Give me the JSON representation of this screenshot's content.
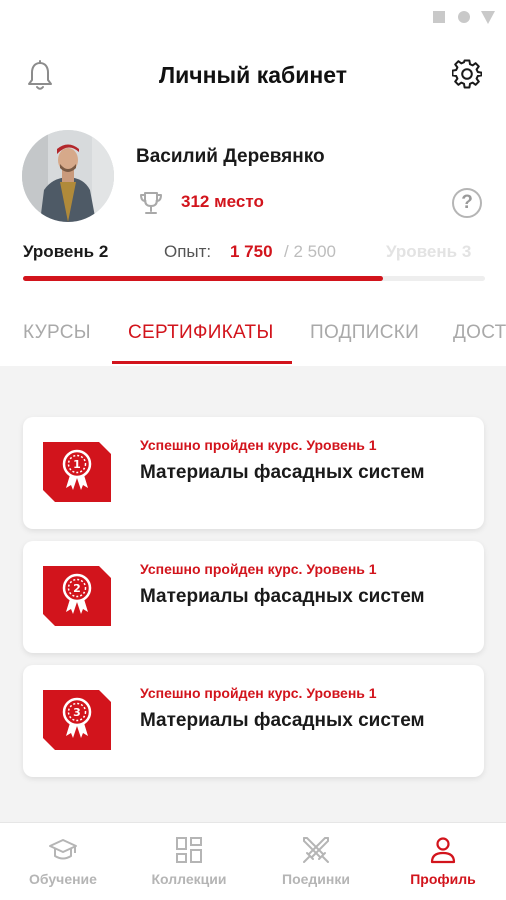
{
  "colors": {
    "accent": "#d2141c",
    "muted": "#a9a9a9",
    "background": "#f3f3f3"
  },
  "header": {
    "title": "Личный кабинет",
    "left_icon": "bell-icon",
    "right_icon": "gear-icon"
  },
  "profile": {
    "name": "Василий Деревянко",
    "rank": "312 место",
    "rank_icon": "trophy-icon",
    "help_icon": "help-icon",
    "help_glyph": "?"
  },
  "level": {
    "current": "Уровень 2",
    "exp_label": "Опыт:",
    "exp_current": "1 750",
    "exp_max": "/ 2 500",
    "next": "Уровень 3",
    "progress": 0.78
  },
  "tabs": [
    {
      "label": "КУРСЫ",
      "active": false
    },
    {
      "label": "СЕРТИФИКАТЫ",
      "active": true
    },
    {
      "label": "ПОДПИСКИ",
      "active": false
    },
    {
      "label": "ДОСТИЖЕНИЯ",
      "active": false
    }
  ],
  "certificates": [
    {
      "badge_number": "1",
      "status": "Успешно пройден курс. Уровень 1",
      "title": "Материалы фасадных систем"
    },
    {
      "badge_number": "2",
      "status": "Успешно пройден курс. Уровень 1",
      "title": "Материалы фасадных систем"
    },
    {
      "badge_number": "3",
      "status": "Успешно пройден курс. Уровень 1",
      "title": "Материалы фасадных систем"
    }
  ],
  "bottom_nav": [
    {
      "label": "Обучение",
      "icon": "graduation-cap-icon",
      "active": false
    },
    {
      "label": "Коллекции",
      "icon": "grid-icon",
      "active": false
    },
    {
      "label": "Поединки",
      "icon": "crossed-swords-icon",
      "active": false
    },
    {
      "label": "Профиль",
      "icon": "user-icon",
      "active": true
    }
  ]
}
